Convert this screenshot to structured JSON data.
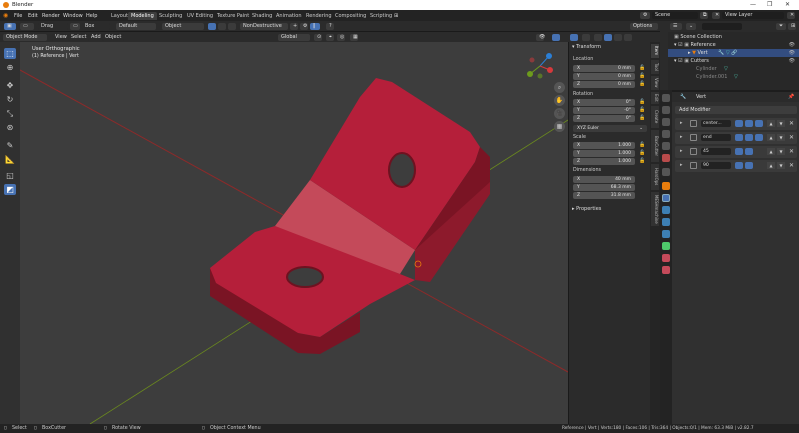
{
  "window": {
    "title": "Blender"
  },
  "menu": {
    "items": [
      "File",
      "Edit",
      "Render",
      "Window",
      "Help"
    ]
  },
  "workspaces": [
    {
      "label": "Layout",
      "active": false
    },
    {
      "label": "Modeling",
      "active": true
    },
    {
      "label": "Sculpting",
      "active": false
    },
    {
      "label": "UV Editing",
      "active": false
    },
    {
      "label": "Texture Paint",
      "active": false
    },
    {
      "label": "Shading",
      "active": false
    },
    {
      "label": "Animation",
      "active": false
    },
    {
      "label": "Rendering",
      "active": false
    },
    {
      "label": "Compositing",
      "active": false
    },
    {
      "label": "Scripting",
      "active": false
    }
  ],
  "scene": {
    "name": "Scene",
    "view_layer": "View Layer"
  },
  "header": {
    "tool_drag": "Drag",
    "tool_mode": "Box",
    "brush": "Default",
    "object_dropdown": "Object",
    "nondestructive": "NonDestructive",
    "options": "Options"
  },
  "vpheader": {
    "mode": "Object Mode",
    "view": "View",
    "select": "Select",
    "add": "Add",
    "object": "Object",
    "transform_orientation": "Global"
  },
  "viewport": {
    "view_name": "User Orthographic",
    "collection_info": "(1) Reference | Vert"
  },
  "npanel": {
    "transform_label": "Transform",
    "location_label": "Location",
    "location": [
      {
        "axis": "X",
        "value": "0 mm"
      },
      {
        "axis": "Y",
        "value": "0 mm"
      },
      {
        "axis": "Z",
        "value": "0 mm"
      }
    ],
    "rotation_label": "Rotation",
    "rotation": [
      {
        "axis": "X",
        "value": "0°"
      },
      {
        "axis": "Y",
        "value": "-0°"
      },
      {
        "axis": "Z",
        "value": "0°"
      }
    ],
    "rotation_mode": "XYZ Euler",
    "scale_label": "Scale",
    "scale": [
      {
        "axis": "X",
        "value": "1.000"
      },
      {
        "axis": "Y",
        "value": "1.000"
      },
      {
        "axis": "Z",
        "value": "1.000"
      }
    ],
    "dimensions_label": "Dimensions",
    "dimensions": [
      {
        "axis": "X",
        "value": "40 mm"
      },
      {
        "axis": "Y",
        "value": "68.3 mm"
      },
      {
        "axis": "Z",
        "value": "31.8 mm"
      }
    ],
    "properties_label": "Properties",
    "tabs": [
      "Item",
      "Tool",
      "View",
      "Edit",
      "Create",
      "BoxCutter",
      "HardOps",
      "MESHmachine"
    ]
  },
  "outliner": {
    "items": [
      {
        "label": "Scene Collection",
        "indent": 0,
        "selected": false
      },
      {
        "label": "Reference",
        "indent": 1,
        "selected": false
      },
      {
        "label": "Vert",
        "indent": 2,
        "selected": true
      },
      {
        "label": "Cutters",
        "indent": 1,
        "selected": false
      },
      {
        "label": "Cylinder",
        "indent": 2,
        "selected": false
      },
      {
        "label": "Cylinder.001",
        "indent": 2,
        "selected": false
      }
    ]
  },
  "properties": {
    "object_name": "Vert",
    "add_modifier": "Add Modifier",
    "modifiers": [
      {
        "name": "center..."
      },
      {
        "name": "end"
      },
      {
        "name": "45"
      },
      {
        "name": "90"
      }
    ]
  },
  "statusbar": {
    "select": "Select",
    "boxcutter": "BoxCutter",
    "rotate_view": "Rotate View",
    "context_menu": "Object Context Menu",
    "stats": "Reference | Vert | Verts:180 | Faces:106 | Tris:364 | Objects:0/1 | Mem: 63.3 MiB | v2.82.7"
  },
  "colors": {
    "object": "#b51f3a",
    "accent": "#4772b3",
    "x_axis": "#8c2a2a",
    "y_axis": "#6b8a1e"
  }
}
